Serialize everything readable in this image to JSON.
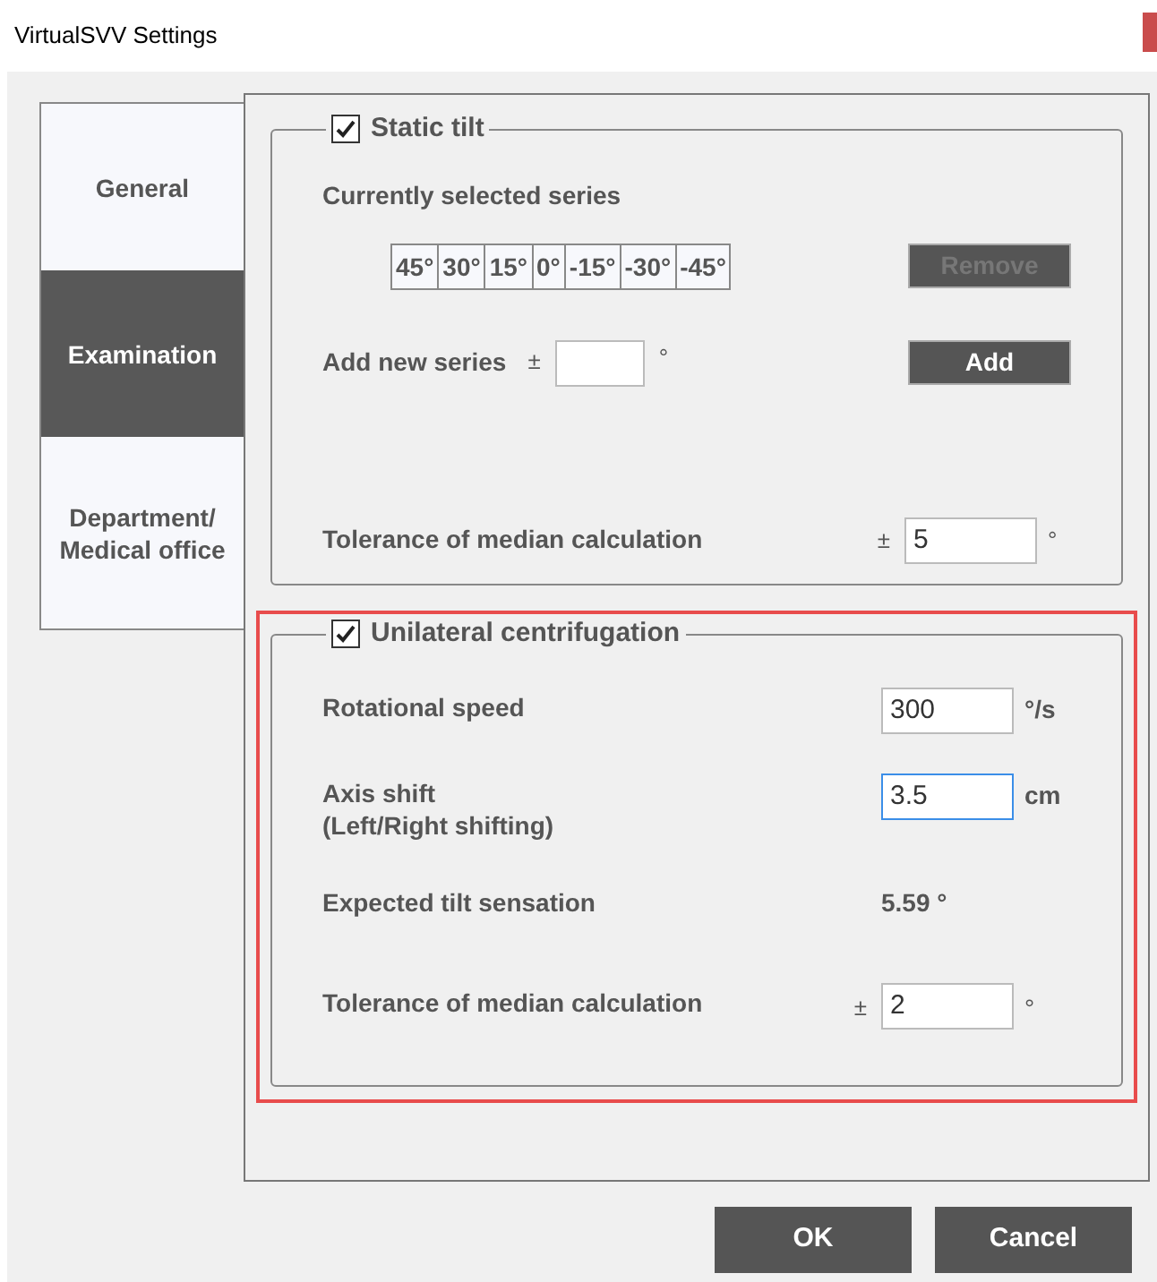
{
  "window": {
    "title": "VirtualSVV Settings"
  },
  "tabs": [
    {
      "label": "General",
      "selected": false
    },
    {
      "label": "Examination",
      "selected": true
    },
    {
      "label": "Department/ Medical office",
      "selected": false
    }
  ],
  "static_tilt": {
    "title": "Static tilt",
    "checked": true,
    "series_label": "Currently selected series",
    "series": [
      "45°",
      "30°",
      "15°",
      "0°",
      "-15°",
      "-30°",
      "-45°"
    ],
    "remove_button": {
      "label": "Remove",
      "disabled": true
    },
    "add_label": "Add new series",
    "add_sign": "±",
    "add_unit": "°",
    "add_button": {
      "label": "Add",
      "disabled": false
    },
    "tolerance": {
      "label": "Tolerance of median calculation",
      "sign": "±",
      "value": "5",
      "unit": "°"
    }
  },
  "unilateral": {
    "title": "Unilateral centrifugation",
    "checked": true,
    "highlighted": true,
    "rows": [
      {
        "kind": "field",
        "label": "Rotational speed",
        "value": "300",
        "unit": "°/s",
        "focused": false
      },
      {
        "kind": "field",
        "label": "Axis shift",
        "sublabel": "(Left/Right shifting)",
        "value": "3.5",
        "unit": "cm",
        "focused": true
      },
      {
        "kind": "readout",
        "label": "Expected tilt sensation",
        "value": "5.59",
        "unit": "°"
      },
      {
        "kind": "field",
        "label": "Tolerance of median calculation",
        "sign": "±",
        "value": "2",
        "unit": "°",
        "focused": false
      }
    ]
  },
  "buttons": [
    {
      "label": "OK"
    },
    {
      "label": "Cancel"
    }
  ]
}
